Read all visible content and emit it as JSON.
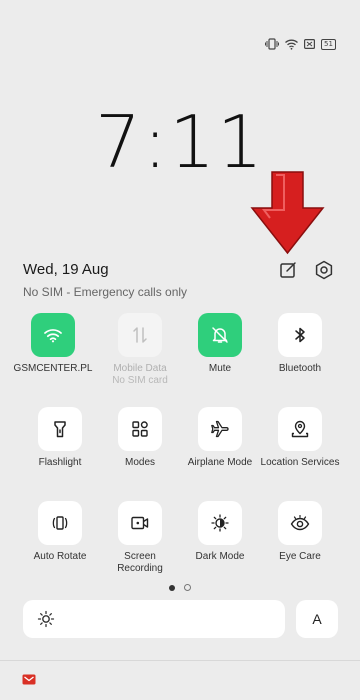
{
  "status_bar": {
    "battery_level": "51",
    "icons": [
      "vibrate-icon",
      "wifi-icon",
      "sim-icon",
      "battery-icon"
    ]
  },
  "lock": {
    "time": "7:11"
  },
  "header": {
    "date": "Wed, 19 Aug",
    "sim_status": "No SIM - Emergency calls only"
  },
  "tiles": [
    {
      "label": "GSMCENTER.PL",
      "sublabel": "",
      "icon": "wifi-icon",
      "state": "on"
    },
    {
      "label": "Mobile Data",
      "sublabel": "No SIM card",
      "icon": "mobile-data-icon",
      "state": "disabled"
    },
    {
      "label": "Mute",
      "sublabel": "",
      "icon": "bell-off-icon",
      "state": "on"
    },
    {
      "label": "Bluetooth",
      "sublabel": "",
      "icon": "bluetooth-icon",
      "state": "off"
    },
    {
      "label": "Flashlight",
      "sublabel": "",
      "icon": "flashlight-icon",
      "state": "off"
    },
    {
      "label": "Modes",
      "sublabel": "",
      "icon": "modes-icon",
      "state": "off"
    },
    {
      "label": "Airplane Mode",
      "sublabel": "",
      "icon": "airplane-icon",
      "state": "off"
    },
    {
      "label": "Location Services",
      "sublabel": "",
      "icon": "location-icon",
      "state": "off"
    },
    {
      "label": "Auto Rotate",
      "sublabel": "",
      "icon": "auto-rotate-icon",
      "state": "off"
    },
    {
      "label": "Screen Recording",
      "sublabel": "",
      "icon": "screen-record-icon",
      "state": "off"
    },
    {
      "label": "Dark Mode",
      "sublabel": "",
      "icon": "dark-mode-icon",
      "state": "off"
    },
    {
      "label": "Eye Care",
      "sublabel": "",
      "icon": "eye-icon",
      "state": "off"
    }
  ],
  "pager": {
    "current": 1,
    "total": 2
  },
  "brightness": {
    "auto_label": "A"
  },
  "colors": {
    "accent": "#2fcf7c",
    "arrow": "#d61f1f"
  }
}
